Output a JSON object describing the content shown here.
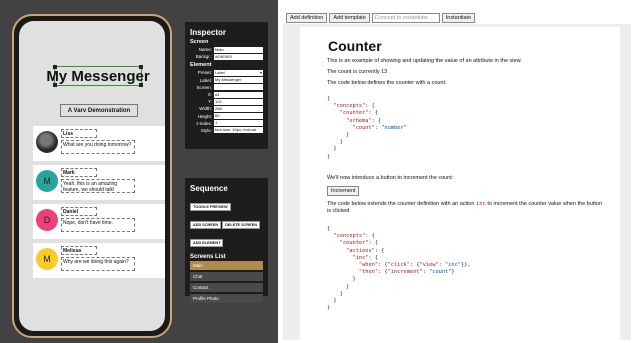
{
  "phone": {
    "app_title": "My Messenger",
    "subtitle": "A Varv Demonstration",
    "chats": [
      {
        "name": "Liss",
        "message": "What are you doing tomorrow?",
        "initial": "",
        "color": "photo"
      },
      {
        "name": "Mark",
        "message": "Yeah, this is an amazing feature, we should talk!",
        "initial": "M",
        "color": "#26a69a"
      },
      {
        "name": "Daniel",
        "message": "Nope, don't have time.",
        "initial": "D",
        "color": "#ec407a"
      },
      {
        "name": "Melissa",
        "message": "Why are we doing this again?",
        "initial": "M",
        "color": "#ffca28"
      }
    ]
  },
  "inspector": {
    "title": "Inspector",
    "screen_heading": "Screen",
    "screen_fields": [
      {
        "label": "Name:",
        "value": "Main"
      },
      {
        "label": "Backgr.:",
        "value": "#E0E0E0"
      }
    ],
    "element_heading": "Element",
    "element_fields": [
      {
        "label": "Preset:",
        "value": "Label"
      },
      {
        "label": "Label:",
        "value": "My Messenger"
      },
      {
        "label": "Screen:",
        "value": ""
      },
      {
        "label": "X:",
        "value": "64"
      },
      {
        "label": "Y:",
        "value": "124"
      },
      {
        "label": "Width:",
        "value": "288"
      },
      {
        "label": "Height:",
        "value": "60"
      },
      {
        "label": "z-index:",
        "value": "1"
      },
      {
        "label": "Style:",
        "value": "font-size: 40px; font-we"
      }
    ]
  },
  "sequence": {
    "title": "Sequence",
    "toggle_preview": "TOGGLE PREVIEW",
    "add_screen": "ADD SCREEN",
    "delete_screen": "DELETE SCREEN",
    "add_element": "ADD ELEMENT",
    "screens_heading": "Screens List",
    "screens": [
      "Main",
      "Chat",
      "Contact",
      "Profile Photo"
    ],
    "active_screen": "Main"
  },
  "toolbar": {
    "add_definition": "Add definition",
    "add_template": "Add template",
    "concept_placeholder": "Concept to instantiate",
    "instantiate": "Instantiate"
  },
  "doc": {
    "title": "Counter",
    "intro": "This is an example of showing and updating the value of an attribute in the view.",
    "count_text": "The count is currently 13",
    "below_text": "The code below defines the counter with a count.",
    "code1": [
      "{",
      "  \"concepts\": {",
      "    \"counter\": {",
      "      \"schema\": {",
      "        \"count\": \"number\"",
      "      }",
      "    }",
      "  }",
      "}"
    ],
    "intro_button_text": "We'll now introduce a button to increment the count:",
    "increment_label": "Increment",
    "extends_text_1": "The code below extends the counter definition with an action",
    "extends_code": "inc",
    "extends_text_2": "to increment the counter value when the button",
    "extends_text_3": "is clicked",
    "code2": [
      "{",
      "  \"concepts\": {",
      "    \"counter\": {",
      "      \"actions\": {",
      "        \"inc\": {",
      "          \"when\": {\"click\": {\"view\": \"inc\"}},",
      "          \"then\": {\"increment\": \"count\"}",
      "        }",
      "      }",
      "    }",
      "  }",
      "}"
    ]
  }
}
